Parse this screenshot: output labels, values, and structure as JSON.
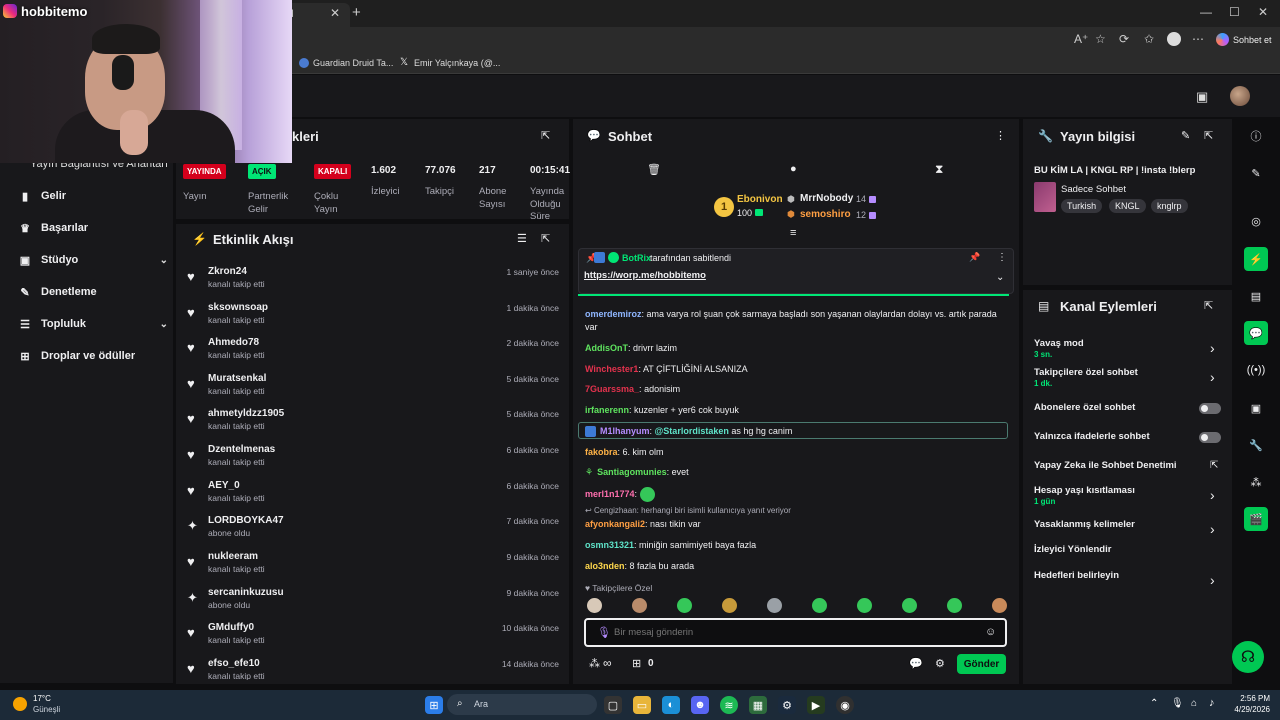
{
  "browser": {
    "tab_fragment": "d",
    "tab_close": "✕",
    "new_tab": "+",
    "win_min": "—",
    "win_max": "☐",
    "win_close": "✕",
    "bookmarks": [
      "Guardian Druid Ta...",
      "Emir Yalçınkaya (@..."
    ],
    "sohbet_et": "Sohbet et",
    "toolbar_icons": [
      "A⁺",
      "☆",
      "⟳",
      "✩",
      "⋯"
    ]
  },
  "webcam": {
    "channel_name": "hobbitemo"
  },
  "leftnav": {
    "partial_label": "Yayın Bağlantısı ve Anahtarı",
    "items": [
      {
        "label": "Gelir",
        "icon": "chart-icon",
        "glyph": "▮"
      },
      {
        "label": "Başarılar",
        "icon": "trophy-icon",
        "glyph": "♛"
      },
      {
        "label": "Stüdyo",
        "icon": "studio-icon",
        "glyph": "▣",
        "chevron": "⌄"
      },
      {
        "label": "Denetleme",
        "icon": "wrench-icon",
        "glyph": "✎"
      },
      {
        "label": "Topluluk",
        "icon": "community-icon",
        "glyph": "☰",
        "chevron": "⌄"
      },
      {
        "label": "Droplar ve ödüller",
        "icon": "drops-icon",
        "glyph": "⊞"
      }
    ]
  },
  "stats": {
    "title_fragment": "kleri",
    "yayin": {
      "badge": "YAYINDA",
      "label": "Yayın"
    },
    "partner": {
      "badge": "AÇIK",
      "label_line1": "Partnerlik",
      "label_line2": "Gelir"
    },
    "coklu": {
      "badge": "KAPALI",
      "label_line1": "Çoklu",
      "label_line2": "Yayın"
    },
    "izleyici": {
      "value": "1.602",
      "label": "İzleyici"
    },
    "takipci": {
      "value": "77.076",
      "label": "Takipçi"
    },
    "abone": {
      "value": "217",
      "label_line1": "Abone",
      "label_line2": "Sayısı"
    },
    "sure": {
      "value": "00:15:41",
      "label_line1": "Yayında",
      "label_line2": "Olduğu",
      "label_line3": "Süre"
    }
  },
  "feed": {
    "title": "Etkinlik Akışı",
    "items": [
      {
        "name": "Zkron24",
        "action": "kanalı takip etti",
        "time": "1 saniye önce",
        "icon": "heart-icon"
      },
      {
        "name": "sksownsoap",
        "action": "kanalı takip etti",
        "time": "1 dakika önce",
        "icon": "heart-icon"
      },
      {
        "name": "Ahmedo78",
        "action": "kanalı takip etti",
        "time": "2 dakika önce",
        "icon": "heart-icon"
      },
      {
        "name": "Muratsenkal",
        "action": "kanalı takip etti",
        "time": "5 dakika önce",
        "icon": "heart-icon"
      },
      {
        "name": "ahmetyldzz1905",
        "action": "kanalı takip etti",
        "time": "5 dakika önce",
        "icon": "heart-icon"
      },
      {
        "name": "Dzentelmenas",
        "action": "kanalı takip etti",
        "time": "6 dakika önce",
        "icon": "heart-icon"
      },
      {
        "name": "AEY_0",
        "action": "kanalı takip etti",
        "time": "6 dakika önce",
        "icon": "heart-icon"
      },
      {
        "name": "LORDBOYKA47",
        "action": "abone oldu",
        "time": "7 dakika önce",
        "icon": "sparkle-icon"
      },
      {
        "name": "nukleeram",
        "action": "kanalı takip etti",
        "time": "9 dakika önce",
        "icon": "heart-icon"
      },
      {
        "name": "sercaninkuzusu",
        "action": "abone oldu",
        "time": "9 dakika önce",
        "icon": "sparkle-icon"
      },
      {
        "name": "GMduffy0",
        "action": "kanalı takip etti",
        "time": "10 dakika önce",
        "icon": "heart-icon"
      },
      {
        "name": "efso_efe10",
        "action": "kanalı takip etti",
        "time": "14 dakika önce",
        "icon": "heart-icon"
      }
    ]
  },
  "chat": {
    "title": "Sohbet",
    "leaderboard": {
      "first_name": "Ebonivon",
      "first_value": "100",
      "second_name": "MrrNobody",
      "second_value": "14",
      "third_name": "semoshiro",
      "third_value": "12",
      "rank": "1"
    },
    "pinned": {
      "by_user": "BotRix",
      "by_text": "tarafından sabitlendi",
      "link": "https://worp.me/hobbitemo"
    },
    "messages": [
      {
        "user": "omerdemiroz",
        "color": "#8fb6ff",
        "text": "ama varya rol şuan çok sarmaya başladı son yaşanan olaylardan dolayı vs. artık parada var"
      },
      {
        "user": "AddisOnT",
        "color": "#5fe35f",
        "text": "drivrr lazim"
      },
      {
        "user": "Winchester1",
        "color": "#e2324d",
        "text": "AT ÇİFTLİĞİNİ ALSANIZA"
      },
      {
        "user": "7Guarssma_",
        "color": "#e2324d",
        "text": "adonisim"
      },
      {
        "user": "irfanerenn",
        "color": "#5fe35f",
        "text": "kuzenler + yer6 cok buyuk"
      },
      {
        "user": "M1lhanyum",
        "color": "#b58cff",
        "text": "@Starlordistaken as hg hg canim",
        "mention": "@Starlordistaken",
        "rest": " as hg hg canim"
      },
      {
        "user": "fakobra",
        "color": "#ffb347",
        "text": "6. kim olm"
      },
      {
        "user": "Santiagomunies",
        "color": "#5fe35f",
        "text": "evet"
      },
      {
        "user": "merl1n1774",
        "color": "#ff6fae",
        "text": ""
      },
      {
        "user": "afyonkangali2",
        "color": "#ff9f43",
        "text": "nası tikin var"
      },
      {
        "user": "osmn31321",
        "color": "#5fe3c9",
        "text": "miniğin samimiyeti baya fazla"
      },
      {
        "user": "alo3nden",
        "color": "#ffd84d",
        "text": "8 fazla bu arada"
      }
    ],
    "reply_hint": "Cengizhaan: herhangi biri isimli kullanıcıya yanıt veriyor",
    "followers_only": "Takipçilere Özel",
    "input_placeholder": "Bir mesaj gönderin",
    "send": "Gönder",
    "points": "0",
    "infinity": "∞"
  },
  "info": {
    "title": "Yayın bilgisi",
    "stream_title": "BU KİM LA | KNGL RP | !insta !blerp",
    "category": "Sadece Sohbet",
    "tags": [
      "Turkish",
      "KNGL",
      "knglrp"
    ]
  },
  "actions": {
    "title": "Kanal Eylemleri",
    "items": [
      {
        "label": "Yavaş mod",
        "sub": "3 sn.",
        "control": "chevron"
      },
      {
        "label": "Takipçilere özel sohbet",
        "sub": "1 dk.",
        "control": "chevron"
      },
      {
        "label": "Abonelere özel sohbet",
        "sub": "",
        "control": "toggle"
      },
      {
        "label": "Yalnızca ifadelerle sohbet",
        "sub": "",
        "control": "toggle"
      },
      {
        "label": "Yapay Zeka ile Sohbet Denetimi",
        "sub": "",
        "control": "external"
      },
      {
        "label": "Hesap yaşı kısıtlaması",
        "sub": "1 gün",
        "control": "chevron"
      },
      {
        "label": "Yasaklanmış kelimeler",
        "sub": "",
        "control": "chevron"
      },
      {
        "label": "İzleyici Yönlendir",
        "sub": "",
        "control": "none"
      },
      {
        "label": "Hedefleri belirleyin",
        "sub": "",
        "control": "chevron"
      }
    ]
  },
  "taskbar": {
    "weather_temp": "17°C",
    "weather_desc": "Güneşli",
    "search": "Ara",
    "time": "2:56 PM",
    "date": "4/29/2026"
  },
  "colors": {
    "accent": "#00c853",
    "live_red": "#d4001c",
    "bg": "#0e0e10",
    "panel": "#18181b"
  }
}
